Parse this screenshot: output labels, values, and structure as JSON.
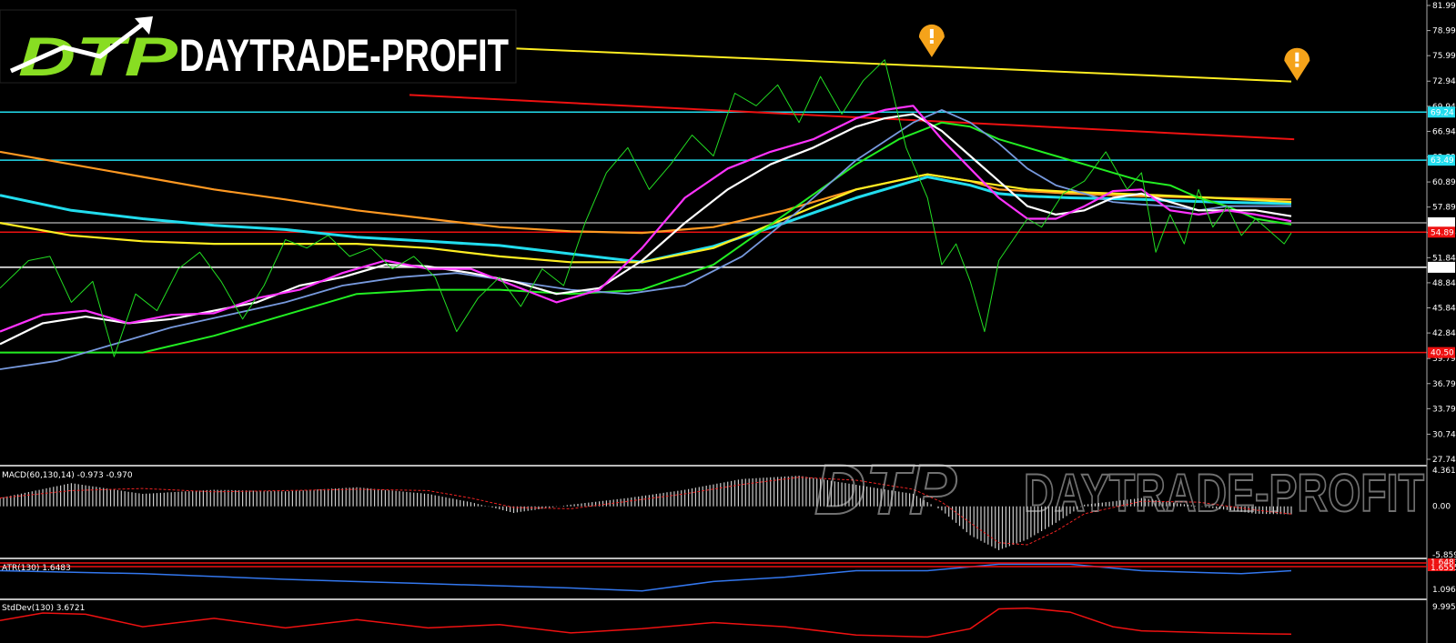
{
  "logo": {
    "mark": "DTP",
    "name": "DAYTRADE-PROFIT",
    "watermark_mark": "DTP",
    "watermark_name": "DAYTRADE-PROFIT"
  },
  "colors": {
    "background": "#000000",
    "price": "#22dd22",
    "magenta": "#ff33ff",
    "white": "#ffffff",
    "steelblue": "#7799dd",
    "green": "#22ee22",
    "cyan": "#22ddee",
    "orange": "#ff9922",
    "yellow": "#ffee22",
    "red": "#ee1111",
    "alert": "#f5a31a"
  },
  "chart_data": {
    "type": "line",
    "price_axis": {
      "ticks": [
        "81.99",
        "78.99",
        "75.99",
        "72.94",
        "69.94",
        "66.94",
        "63.89",
        "60.89",
        "57.89",
        "54.84",
        "51.84",
        "48.84",
        "45.84",
        "42.84",
        "39.79",
        "36.79",
        "33.79",
        "30.74",
        "27.74"
      ],
      "ylim": [
        27.74,
        81.99
      ],
      "price_labels": [
        {
          "text": "69.24",
          "value": 69.24,
          "color": "#22ddee"
        },
        {
          "text": "63.49",
          "value": 63.49,
          "color": "#22ddee"
        },
        {
          "text": "56.01",
          "value": 56.01,
          "color": "#ffffff"
        },
        {
          "text": "54.89",
          "value": 54.89,
          "color": "#ee1111"
        },
        {
          "text": "50.69",
          "value": 50.69,
          "color": "#ffffff"
        },
        {
          "text": "40.50",
          "value": 40.5,
          "color": "#ee1111"
        }
      ]
    },
    "horizontal_levels": [
      {
        "value": 69.24,
        "color": "#22ddee"
      },
      {
        "value": 63.49,
        "color": "#22ddee"
      },
      {
        "value": 56.01,
        "color": "#999999"
      },
      {
        "value": 54.89,
        "color": "#ee1111"
      },
      {
        "value": 50.69,
        "color": "#ffffff"
      },
      {
        "value": 40.5,
        "color": "#ee1111"
      }
    ],
    "trendlines": [
      {
        "color": "#ffee22",
        "x": [
          0.355,
          0.905
        ],
        "y": [
          76.9,
          72.9
        ]
      },
      {
        "color": "#ee1111",
        "x": [
          0.287,
          0.907
        ],
        "y": [
          71.3,
          66.0
        ]
      }
    ],
    "series": [
      {
        "color": "#22dd22",
        "width": 1.0,
        "x": [
          0,
          0.02,
          0.035,
          0.05,
          0.065,
          0.08,
          0.095,
          0.11,
          0.125,
          0.14,
          0.155,
          0.17,
          0.185,
          0.2,
          0.215,
          0.23,
          0.245,
          0.26,
          0.275,
          0.29,
          0.305,
          0.32,
          0.335,
          0.35,
          0.365,
          0.38,
          0.395,
          0.41,
          0.425,
          0.44,
          0.455,
          0.47,
          0.485,
          0.5,
          0.515,
          0.53,
          0.545,
          0.56,
          0.575,
          0.59,
          0.605,
          0.62,
          0.635,
          0.65,
          0.66,
          0.67,
          0.68,
          0.69,
          0.7,
          0.71,
          0.72,
          0.73,
          0.745,
          0.76,
          0.775,
          0.79,
          0.8,
          0.81,
          0.82,
          0.83,
          0.84,
          0.85,
          0.86,
          0.87,
          0.88,
          0.89,
          0.9,
          0.905
        ],
        "y": [
          48.2,
          51.5,
          52.0,
          46.5,
          49.0,
          40.0,
          47.5,
          45.5,
          50.5,
          52.5,
          49.0,
          44.5,
          48.5,
          54.0,
          53.0,
          54.5,
          52.0,
          53.0,
          50.5,
          52.0,
          49.5,
          43.0,
          47.0,
          49.5,
          46.0,
          50.5,
          48.5,
          56.0,
          62.0,
          65.0,
          60.0,
          63.0,
          66.5,
          64.0,
          71.5,
          70.0,
          72.5,
          68.0,
          73.5,
          69.0,
          73.0,
          75.5,
          65.0,
          59.0,
          51.0,
          53.5,
          49.0,
          43.0,
          51.5,
          54.0,
          56.5,
          55.5,
          59.5,
          61.0,
          64.5,
          60.0,
          62.0,
          52.5,
          57.0,
          53.5,
          60.0,
          55.5,
          58.0,
          54.5,
          56.5,
          55.0,
          53.5,
          54.8
        ]
      },
      {
        "color": "#ff33ff",
        "width": 2.2,
        "x": [
          0,
          0.03,
          0.06,
          0.09,
          0.12,
          0.15,
          0.18,
          0.21,
          0.24,
          0.27,
          0.3,
          0.33,
          0.36,
          0.39,
          0.42,
          0.45,
          0.48,
          0.51,
          0.54,
          0.57,
          0.6,
          0.62,
          0.64,
          0.66,
          0.68,
          0.7,
          0.72,
          0.74,
          0.76,
          0.78,
          0.8,
          0.82,
          0.84,
          0.86,
          0.88,
          0.905
        ],
        "y": [
          43.0,
          45.0,
          45.5,
          44.0,
          45.0,
          45.2,
          47.0,
          48.0,
          50.0,
          51.5,
          50.5,
          50.5,
          48.5,
          46.5,
          48.0,
          53.0,
          59.0,
          62.5,
          64.5,
          66.0,
          68.5,
          69.5,
          70.0,
          66.0,
          62.5,
          59.0,
          56.5,
          56.5,
          58.0,
          59.8,
          60.0,
          57.5,
          57.0,
          57.5,
          57.0,
          56.2
        ]
      },
      {
        "color": "#ffffff",
        "width": 2.2,
        "x": [
          0,
          0.03,
          0.06,
          0.09,
          0.12,
          0.15,
          0.18,
          0.21,
          0.24,
          0.27,
          0.3,
          0.33,
          0.36,
          0.39,
          0.42,
          0.45,
          0.48,
          0.51,
          0.54,
          0.57,
          0.6,
          0.62,
          0.64,
          0.66,
          0.68,
          0.7,
          0.72,
          0.74,
          0.76,
          0.78,
          0.8,
          0.82,
          0.84,
          0.86,
          0.88,
          0.905
        ],
        "y": [
          41.5,
          44.0,
          44.8,
          44.0,
          44.5,
          45.5,
          46.5,
          48.5,
          49.5,
          51.0,
          50.8,
          50.0,
          49.0,
          47.5,
          48.2,
          51.5,
          56.0,
          60.0,
          63.0,
          65.0,
          67.5,
          68.5,
          69.0,
          67.0,
          64.0,
          61.0,
          58.0,
          57.0,
          57.5,
          59.0,
          59.5,
          58.5,
          57.5,
          57.5,
          57.5,
          56.8
        ]
      },
      {
        "color": "#7799dd",
        "width": 1.8,
        "x": [
          0,
          0.04,
          0.08,
          0.12,
          0.16,
          0.2,
          0.24,
          0.28,
          0.32,
          0.36,
          0.4,
          0.44,
          0.48,
          0.52,
          0.56,
          0.6,
          0.64,
          0.66,
          0.68,
          0.7,
          0.72,
          0.74,
          0.76,
          0.78,
          0.8,
          0.82,
          0.84,
          0.86,
          0.88,
          0.905
        ],
        "y": [
          38.5,
          39.5,
          41.5,
          43.5,
          45.0,
          46.5,
          48.5,
          49.5,
          50.0,
          49.0,
          48.0,
          47.5,
          48.5,
          52.0,
          57.5,
          63.5,
          68.0,
          69.5,
          68.0,
          65.5,
          62.5,
          60.5,
          59.5,
          58.5,
          58.2,
          58.0,
          57.5,
          58.0,
          58.0,
          58.0
        ]
      },
      {
        "color": "#22ee22",
        "width": 2.0,
        "x": [
          0,
          0.05,
          0.1,
          0.15,
          0.2,
          0.25,
          0.3,
          0.35,
          0.4,
          0.45,
          0.5,
          0.55,
          0.6,
          0.63,
          0.66,
          0.68,
          0.7,
          0.72,
          0.74,
          0.76,
          0.78,
          0.8,
          0.82,
          0.84,
          0.86,
          0.88,
          0.905
        ],
        "y": [
          40.5,
          40.5,
          40.5,
          42.5,
          45.0,
          47.5,
          48.0,
          48.0,
          47.5,
          48.0,
          51.0,
          57.0,
          63.0,
          66.0,
          68.0,
          67.5,
          66.0,
          65.0,
          64.0,
          63.0,
          62.0,
          61.0,
          60.5,
          59.0,
          58.0,
          56.5,
          55.8
        ]
      },
      {
        "color": "#22ddee",
        "width": 3.0,
        "x": [
          0,
          0.05,
          0.1,
          0.15,
          0.2,
          0.25,
          0.3,
          0.35,
          0.4,
          0.45,
          0.5,
          0.55,
          0.6,
          0.65,
          0.68,
          0.7,
          0.72,
          0.75,
          0.8,
          0.85,
          0.905
        ],
        "y": [
          59.3,
          57.5,
          56.5,
          55.7,
          55.2,
          54.3,
          53.8,
          53.3,
          52.3,
          51.3,
          53.2,
          56.0,
          59.0,
          61.5,
          60.5,
          59.5,
          59.2,
          59.0,
          58.8,
          58.5,
          58.3
        ]
      },
      {
        "color": "#ff9922",
        "width": 2.2,
        "x": [
          0,
          0.05,
          0.1,
          0.15,
          0.2,
          0.25,
          0.3,
          0.35,
          0.4,
          0.45,
          0.5,
          0.55,
          0.6,
          0.65,
          0.68,
          0.7,
          0.72,
          0.75,
          0.8,
          0.85,
          0.905
        ],
        "y": [
          64.5,
          63.0,
          61.5,
          60.0,
          58.8,
          57.5,
          56.5,
          55.5,
          55.0,
          54.8,
          55.5,
          57.5,
          60.0,
          61.8,
          61.0,
          60.0,
          59.8,
          59.5,
          59.2,
          59.0,
          58.8
        ]
      },
      {
        "color": "#ffee22",
        "width": 2.2,
        "x": [
          0,
          0.05,
          0.1,
          0.15,
          0.2,
          0.25,
          0.3,
          0.35,
          0.4,
          0.45,
          0.5,
          0.55,
          0.6,
          0.65,
          0.68,
          0.7,
          0.72,
          0.75,
          0.8,
          0.85,
          0.905
        ],
        "y": [
          56.0,
          54.5,
          53.8,
          53.5,
          53.5,
          53.5,
          53.0,
          52.0,
          51.3,
          51.3,
          53.0,
          56.5,
          60.0,
          61.8,
          61.0,
          60.5,
          60.0,
          59.7,
          59.4,
          59.0,
          58.5
        ]
      }
    ],
    "alerts": [
      {
        "x": 0.653,
        "value": 75.8
      },
      {
        "x": 0.909,
        "value": 73.0
      }
    ],
    "indicators": [
      {
        "label": "MACD(60,130,14) -0.973 -0.970",
        "ticks": [
          "4.361",
          "0.00",
          "-5.859"
        ],
        "zero": 0.0,
        "ylim": [
          -5.859,
          4.361
        ],
        "hist_color": "#cccccc",
        "signal_color": "#ee2222",
        "hist": {
          "x": [
            0,
            0.05,
            0.1,
            0.15,
            0.2,
            0.25,
            0.3,
            0.33,
            0.36,
            0.4,
            0.44,
            0.48,
            0.52,
            0.56,
            0.6,
            0.64,
            0.66,
            0.68,
            0.7,
            0.72,
            0.74,
            0.76,
            0.8,
            0.84,
            0.88,
            0.905
          ],
          "y": [
            1.0,
            2.8,
            1.5,
            2.0,
            1.8,
            2.3,
            1.5,
            0.5,
            -0.8,
            0.2,
            1.0,
            2.0,
            3.3,
            3.7,
            2.6,
            1.5,
            -0.5,
            -3.5,
            -5.3,
            -4.0,
            -2.0,
            0.2,
            1.0,
            0.0,
            -0.9,
            -0.97
          ]
        }
      },
      {
        "label": "ATR(130) 1.6483",
        "ticks": [
          "1.0961"
        ],
        "value_labels": [
          "1.6483",
          "1.6555"
        ],
        "ylim": [
          0.95,
          1.75
        ],
        "line_color": "#3377ee",
        "line": {
          "x": [
            0,
            0.1,
            0.2,
            0.3,
            0.4,
            0.45,
            0.5,
            0.55,
            0.6,
            0.65,
            0.7,
            0.75,
            0.8,
            0.85,
            0.87,
            0.905
          ],
          "y": [
            1.55,
            1.48,
            1.35,
            1.25,
            1.15,
            1.08,
            1.3,
            1.4,
            1.55,
            1.55,
            1.7,
            1.7,
            1.55,
            1.5,
            1.48,
            1.55
          ]
        }
      },
      {
        "label": "StdDev(130) 3.6721",
        "ticks": [
          "9.9955"
        ],
        "ylim": [
          2.0,
          11.0
        ],
        "line_color": "#ee1111",
        "line": {
          "x": [
            0,
            0.03,
            0.06,
            0.1,
            0.15,
            0.2,
            0.25,
            0.3,
            0.35,
            0.4,
            0.45,
            0.5,
            0.55,
            0.6,
            0.65,
            0.68,
            0.7,
            0.72,
            0.75,
            0.78,
            0.8,
            0.85,
            0.905
          ],
          "y": [
            7.0,
            8.8,
            8.5,
            5.5,
            7.5,
            5.2,
            7.2,
            5.2,
            6.0,
            4.0,
            5.0,
            6.5,
            5.5,
            3.5,
            3.0,
            5.0,
            9.8,
            10.0,
            9.0,
            5.5,
            4.5,
            4.0,
            3.7
          ]
        }
      }
    ]
  }
}
